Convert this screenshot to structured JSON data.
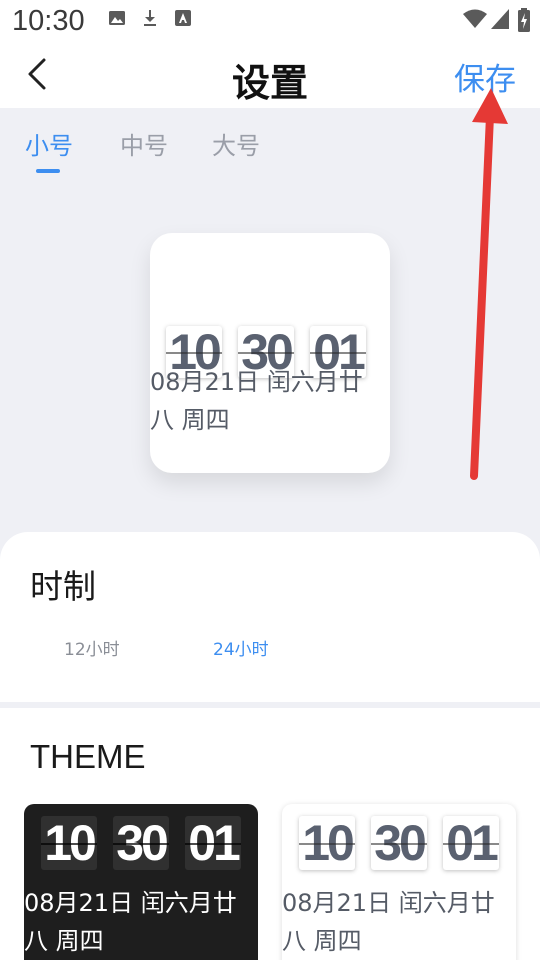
{
  "status_bar": {
    "time": "10:30",
    "left_icons": [
      "image-icon",
      "download-icon",
      "a-square-icon"
    ],
    "right_icons": [
      "wifi-icon",
      "signal-icon",
      "battery-icon"
    ]
  },
  "header": {
    "title": "设置",
    "save_label": "保存",
    "back_icon": "chevron-left-icon"
  },
  "size_tabs": [
    {
      "label": "小号",
      "active": true
    },
    {
      "label": "中号",
      "active": false
    },
    {
      "label": "大号",
      "active": false
    }
  ],
  "preview": {
    "hours": "10",
    "minutes": "30",
    "seconds": "01",
    "date_line1": "08月21日 闰六月廿",
    "date_line2": "八  周四"
  },
  "time_format": {
    "title": "时制",
    "options": [
      {
        "label": "12小时",
        "active": false
      },
      {
        "label": "24小时",
        "active": true
      }
    ]
  },
  "theme_section": {
    "title": "THEME",
    "themes": [
      {
        "name": "dark",
        "hours": "10",
        "minutes": "30",
        "seconds": "01",
        "date_line1": "08月21日 闰六月廿",
        "date_line2": "八  周四"
      },
      {
        "name": "light",
        "hours": "10",
        "minutes": "30",
        "seconds": "01",
        "date_line1": "08月21日 闰六月廿",
        "date_line2": "八  周四"
      }
    ]
  },
  "colors": {
    "accent": "#3d8ef0",
    "background": "#eff0f5",
    "annotation_arrow": "#e53935",
    "dark_theme": "#1e1e1e"
  }
}
